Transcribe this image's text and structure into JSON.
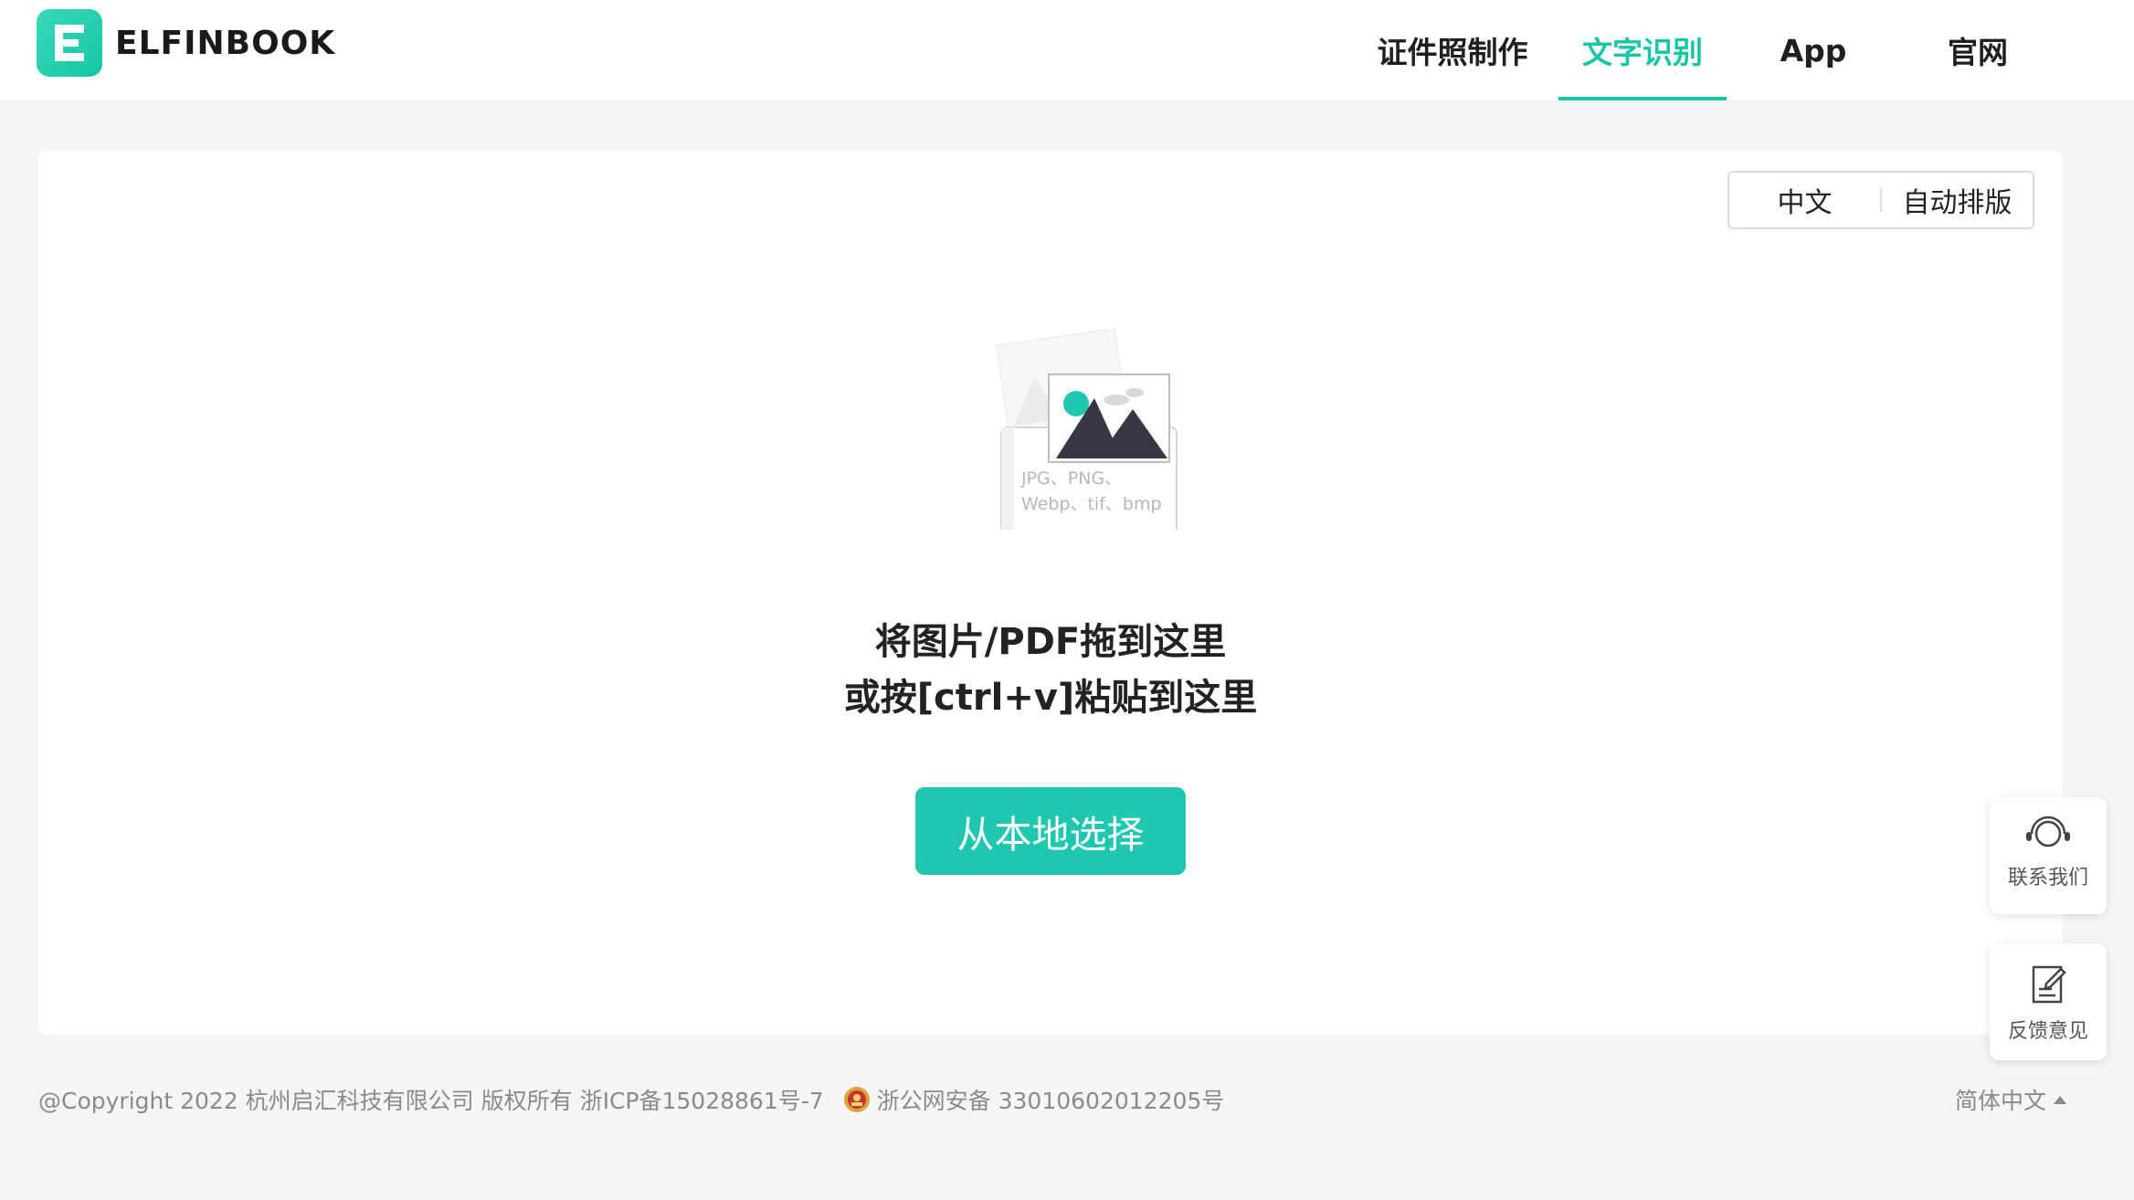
{
  "brand": {
    "name": "ELFINBOOK",
    "accent": "#18c6a5"
  },
  "nav": {
    "items": [
      {
        "label": "证件照制作",
        "active": false
      },
      {
        "label": "文字识别",
        "active": true
      },
      {
        "label": "App",
        "active": false
      },
      {
        "label": "官网",
        "active": false
      }
    ]
  },
  "options": {
    "language": "中文",
    "layout": "自动排版"
  },
  "upload": {
    "formats_line1": "JPG、PNG、",
    "formats_line2": "Webp、tif、bmp",
    "prompt_line1": "将图片/PDF拖到这里",
    "prompt_line2": "或按[ctrl+v]粘贴到这里",
    "select_button": "从本地选择"
  },
  "footer": {
    "copyright": "@Copyright 2022 杭州启汇科技有限公司 版权所有 浙ICP备15028861号-7",
    "police": "浙公网安备 33010602012205号",
    "language": "简体中文"
  },
  "float": {
    "contact": "联系我们",
    "feedback": "反馈意见"
  },
  "icons": {
    "logo": "elfinbook-logo-icon",
    "contact": "headset-icon",
    "feedback": "edit-note-icon",
    "police": "police-badge-icon",
    "language": "caret-up-icon"
  }
}
